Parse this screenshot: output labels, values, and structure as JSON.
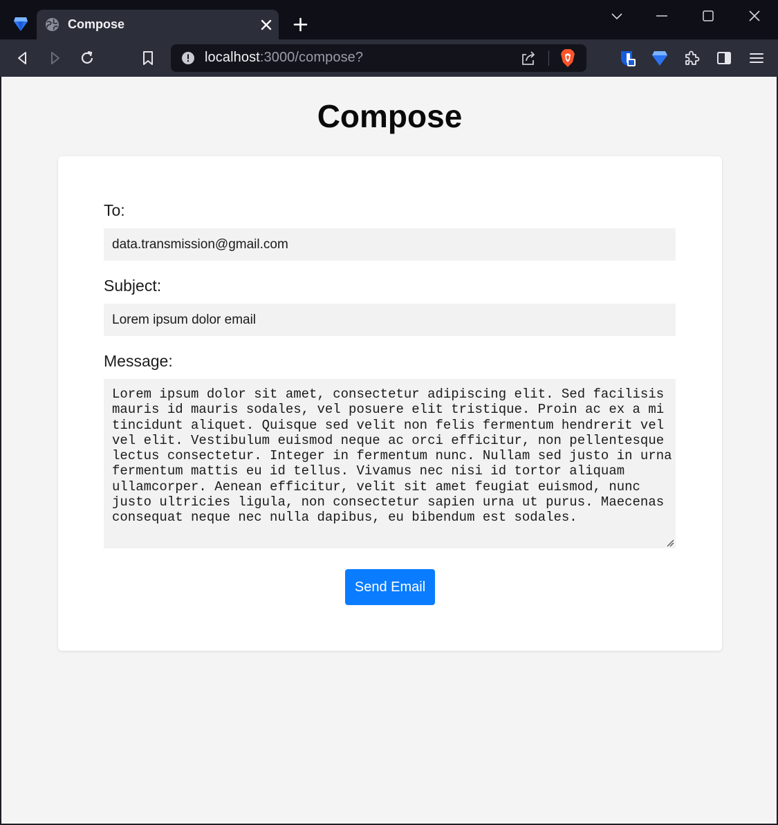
{
  "browser": {
    "tab_title": "Compose",
    "url_host": "localhost",
    "url_rest": ":3000/compose?"
  },
  "page": {
    "title": "Compose"
  },
  "form": {
    "to_label": "To:",
    "to_value": "data.transmission@gmail.com",
    "subject_label": "Subject:",
    "subject_value": "Lorem ipsum dolor email",
    "message_label": "Message:",
    "message_value": "Lorem ipsum dolor sit amet, consectetur adipiscing elit. Sed facilisis mauris id mauris sodales, vel posuere elit tristique. Proin ac ex a mi tincidunt aliquet. Quisque sed velit non felis fermentum hendrerit vel vel elit. Vestibulum euismod neque ac orci efficitur, non pellentesque lectus consectetur. Integer in fermentum nunc. Nullam sed justo in urna fermentum mattis eu id tellus. Vivamus nec nisi id tortor aliquam ullamcorper. Aenean efficitur, velit sit amet feugiat euismod, nunc justo ultricies ligula, non consectetur sapien urna ut purus. Maecenas consequat neque nec nulla dapibus, eu bibendum est sodales.",
    "send_label": "Send Email"
  },
  "colors": {
    "accent": "#0a7cff",
    "page_bg": "#f4f4f4",
    "chrome_bg": "#2c2e3a",
    "titlebar_bg": "#0e0f17",
    "brave_orange": "#fb542b"
  },
  "icons": {
    "browser_logo": "brave-gem-icon",
    "tab_favicon": "globe-icon",
    "tab_close": "close-icon",
    "new_tab": "plus-icon",
    "back": "back-icon",
    "forward": "forward-icon",
    "reload": "reload-icon",
    "bookmark": "bookmark-icon",
    "site_info": "info-icon",
    "share": "share-icon",
    "shields": "brave-shield-icon",
    "extension_1": "bitwarden-icon",
    "extension_2": "wallet-gem-icon",
    "extensions": "puzzle-icon",
    "sidebar": "sidebar-icon",
    "menu": "hamburger-menu-icon"
  }
}
